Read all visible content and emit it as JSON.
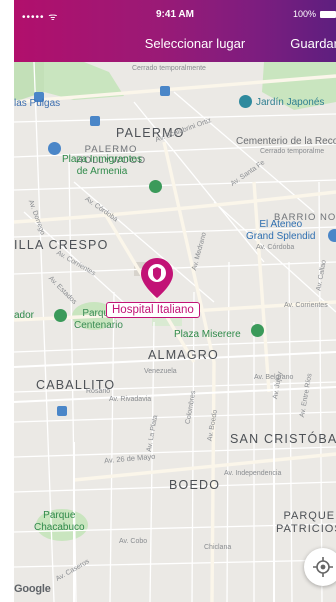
{
  "status_bar": {
    "signal": "••••• ᯤ",
    "time": "9:41 AM",
    "battery": "100%"
  },
  "nav": {
    "title": "Seleccionar lugar",
    "save_label": "Guardar"
  },
  "map": {
    "districts": {
      "palermo": "PALERMO",
      "palermo_hollywood": "PALERMO\nHOLLYWOOD",
      "villa_crespo": "ILLA CRESPO",
      "barrio_norte": "BARRIO NO",
      "almagro": "ALMAGRO",
      "caballito": "CABALLITO",
      "san_cristobal": "SAN CRISTÓBA",
      "boedo": "BOEDO",
      "parque_patricios": "PARQUE\nPATRICIOS"
    },
    "places": {
      "pulgas": "las Pulgas",
      "jardin_japones": "Jardín Japonés",
      "cementerio": "Cementerio de la Recole",
      "cementerio_note": "Cerrado temporalme",
      "planetario_note": "Cerrado temporalmente",
      "plaza_inmigrantes": "Plaza Inmigrantes\nde Armenia",
      "el_ateneo": "El Ateneo\nGrand Splendid",
      "parque_centenario": "Parque\nCentenario",
      "plaza_miserere": "Plaza Miserere",
      "parque_chacabuco": "Parque\nChacabuco",
      "ador": "ador"
    },
    "streets": {
      "santa_fe": "Av. Santa Fe",
      "cordoba": "Av. Córdoba",
      "corrientes": "Av. Corrientes",
      "corrientes2": "Av. Corrientes",
      "medrano": "Av. Medrano",
      "scalabrini": "Av. Scalabrini Ortiz",
      "belgrano": "Av. Belgrano",
      "independencia": "Av. Independencia",
      "rivadavia": "Av. Rivadavia",
      "mayo": "Av. 26 de Mayo",
      "la_plata": "Av. La Plata",
      "boedo_av": "Av. Boedo",
      "caseros": "Av. Caseros",
      "cobo": "Av. Cobo",
      "jujuy": "Av. Jujuy",
      "entre_rios": "Av. Entre Ríos",
      "colombres": "Colombres",
      "venezuela": "Venezuela",
      "rosario": "Rosario",
      "chiclana": "Chiclana",
      "estados": "Av. Estados",
      "dorrego": "Av. Dorrego",
      "callao": "Av. Callao"
    },
    "pin_label": "Hospital Italiano",
    "google_logo": "Google"
  },
  "colors": {
    "header_start": "#b10f6c",
    "header_end": "#5e1f7f",
    "pin": "#c21376",
    "park": "#c8e6c0",
    "road": "#ffffff"
  }
}
